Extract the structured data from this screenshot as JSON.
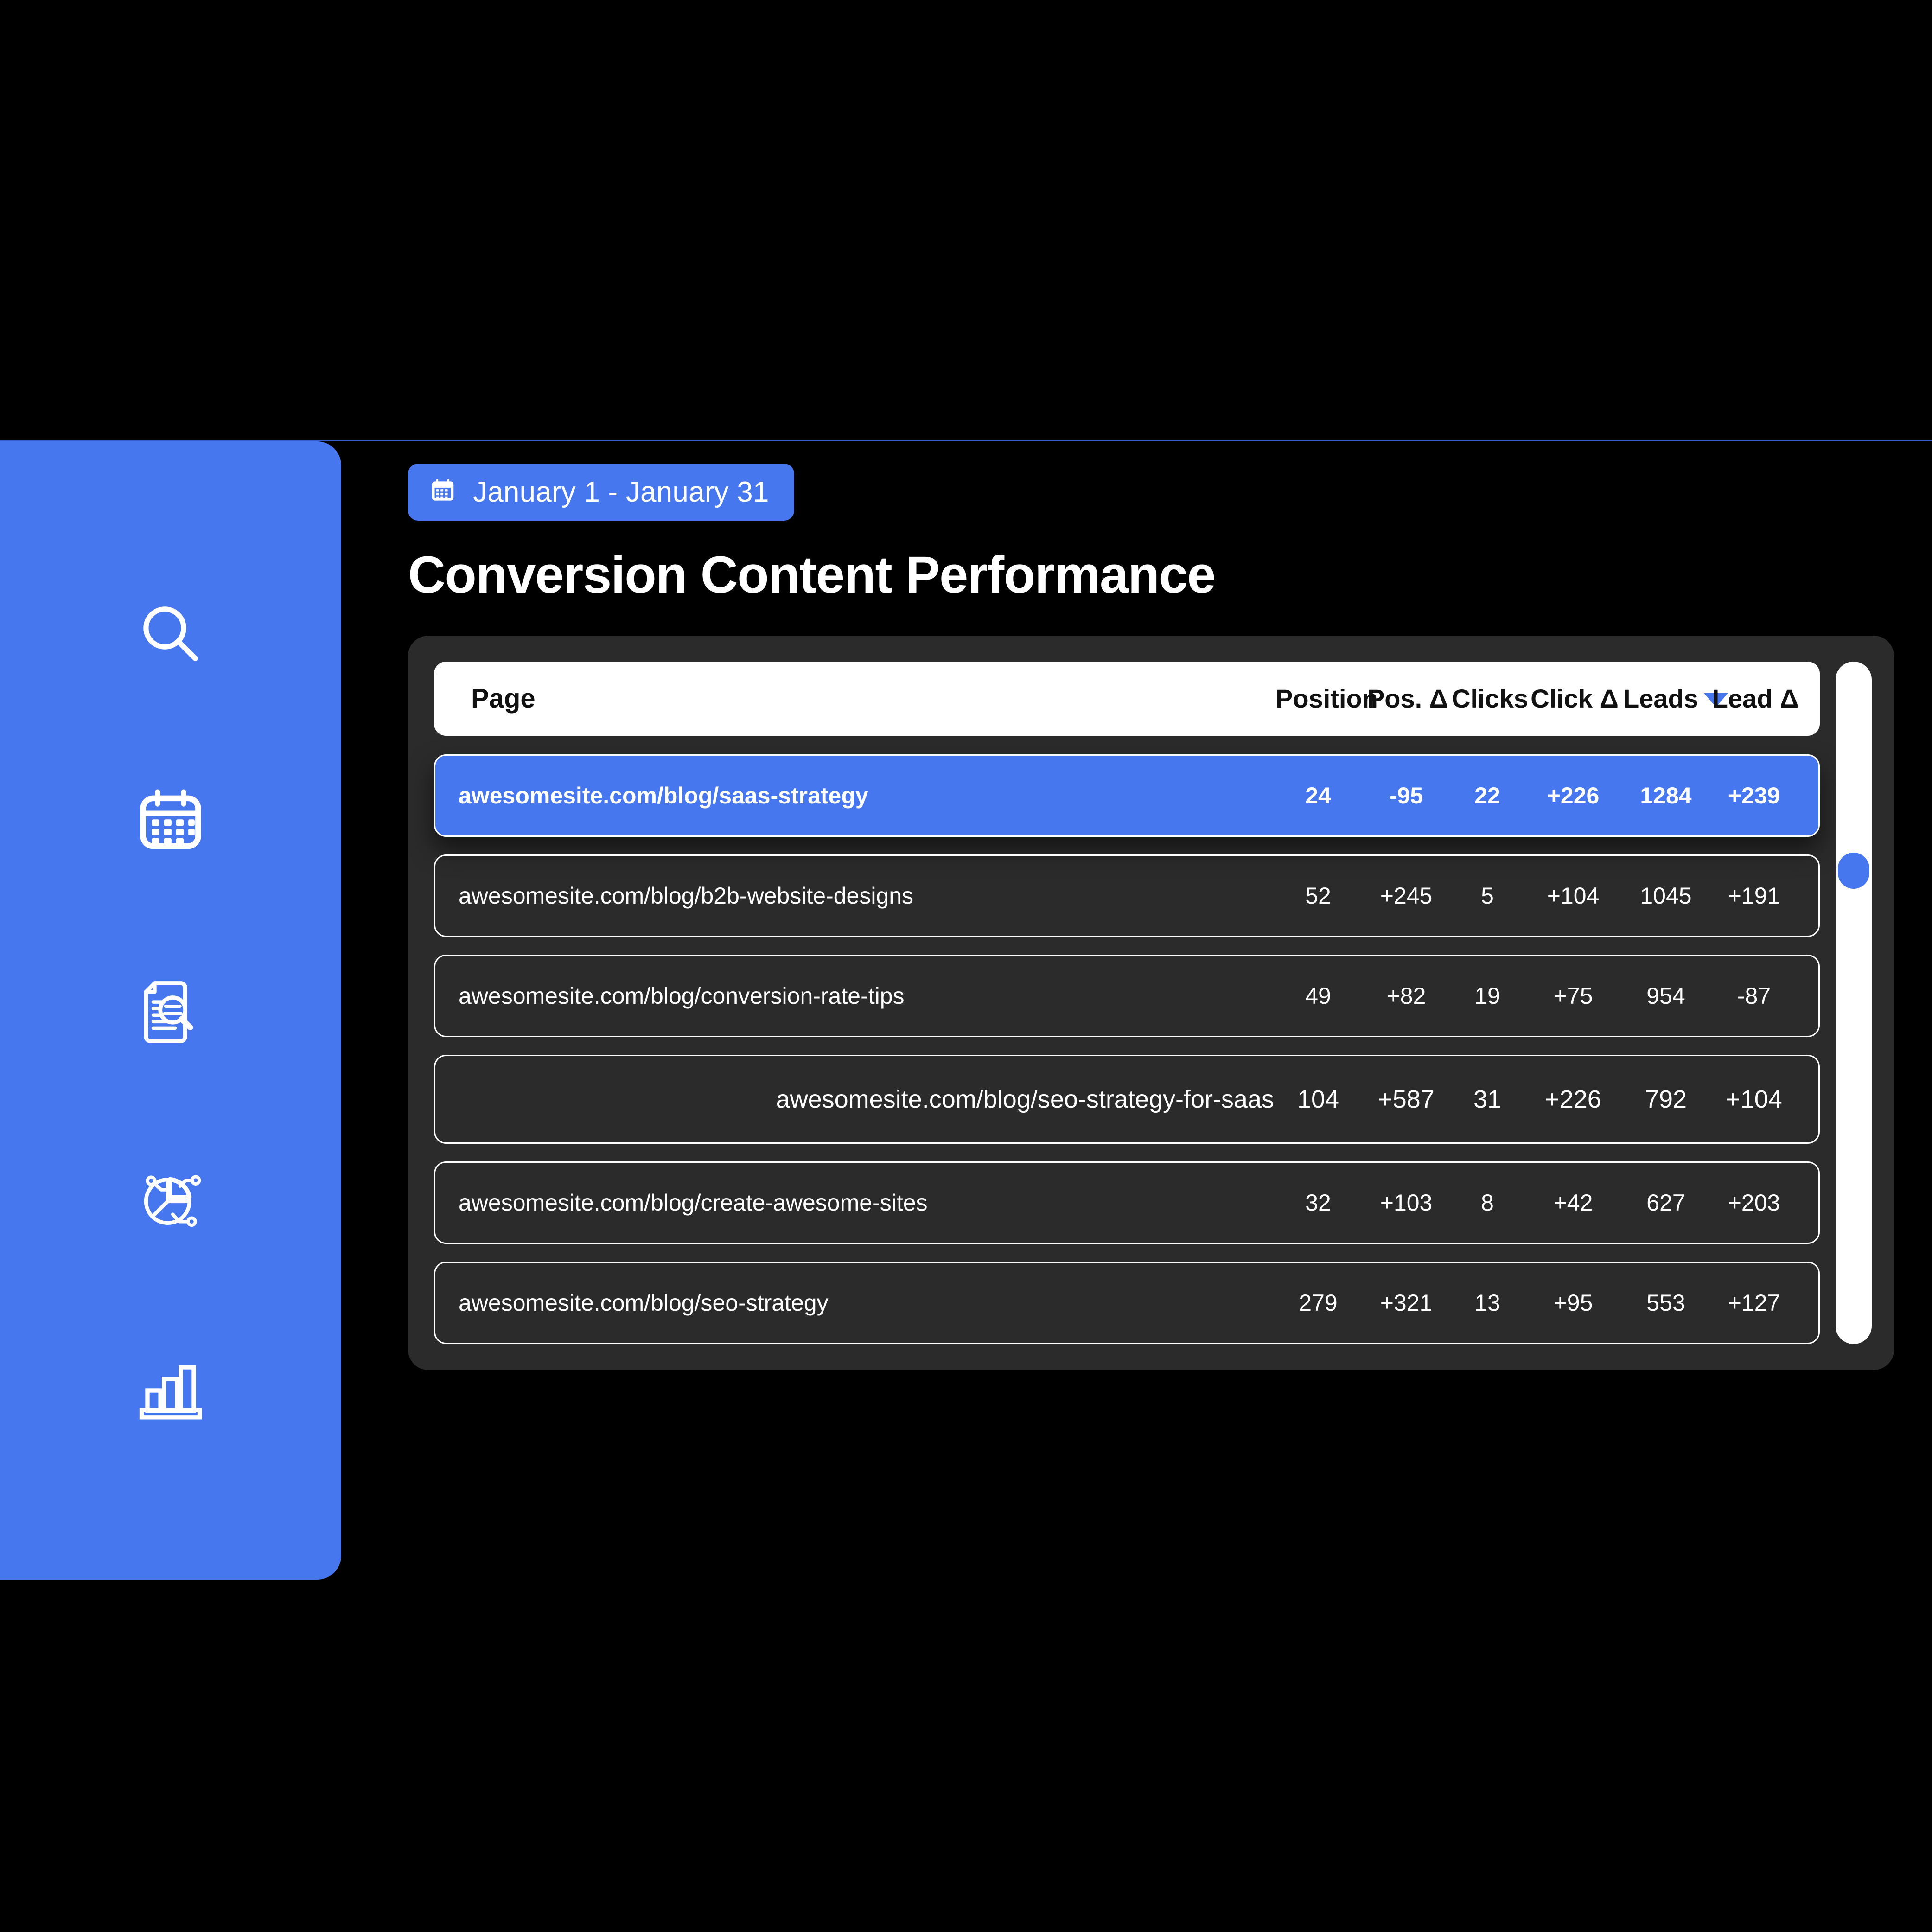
{
  "theme": {
    "background": "#000000",
    "accent": "#4777ee",
    "card_background": "#2b2b2b",
    "header_background": "#ffffff",
    "text_on_dark": "#ffffff",
    "text_on_light": "#111111",
    "divider": "#3b5ccc"
  },
  "sidebar": {
    "items": [
      {
        "icon": "search-icon",
        "name": "sidebar-item-search"
      },
      {
        "icon": "calendar-icon",
        "name": "sidebar-item-calendar"
      },
      {
        "icon": "document-search-icon",
        "name": "sidebar-item-reports"
      },
      {
        "icon": "pie-chart-icon",
        "name": "sidebar-item-analytics"
      },
      {
        "icon": "bar-chart-icon",
        "name": "sidebar-item-performance"
      }
    ]
  },
  "header": {
    "date_range": "January 1 - January 31",
    "date_icon": "calendar-icon",
    "title": "Conversion Content Performance"
  },
  "table": {
    "sort": {
      "column": "Leads",
      "direction": "desc",
      "indicator": "chevron-down-icon"
    },
    "columns": [
      {
        "key": "page",
        "label": "Page"
      },
      {
        "key": "position",
        "label": "Position"
      },
      {
        "key": "pos_d",
        "label": "Pos. Δ"
      },
      {
        "key": "clicks",
        "label": "Clicks"
      },
      {
        "key": "click_d",
        "label": "Click Δ"
      },
      {
        "key": "leads",
        "label": "Leads"
      },
      {
        "key": "lead_d",
        "label": "Lead Δ"
      }
    ],
    "rows": [
      {
        "page": "awesomesite.com/blog/saas-strategy",
        "position": "24",
        "pos_d": "-95",
        "clicks": "22",
        "click_d": "+226",
        "leads": "1284",
        "lead_d": "+239",
        "selected": true
      },
      {
        "page": "awesomesite.com/blog/b2b-website-designs",
        "position": "52",
        "pos_d": "+245",
        "clicks": "5",
        "click_d": "+104",
        "leads": "1045",
        "lead_d": "+191",
        "selected": false
      },
      {
        "page": "awesomesite.com/blog/conversion-rate-tips",
        "position": "49",
        "pos_d": "+82",
        "clicks": "19",
        "click_d": "+75",
        "leads": "954",
        "lead_d": "-87",
        "selected": false
      },
      {
        "page": "awesomesite.com/blog/seo-strategy-for-saas",
        "position": "104",
        "pos_d": "+587",
        "clicks": "31",
        "click_d": "+226",
        "leads": "792",
        "lead_d": "+104",
        "selected": false
      },
      {
        "page": "awesomesite.com/blog/create-awesome-sites",
        "position": "32",
        "pos_d": "+103",
        "clicks": "8",
        "click_d": "+42",
        "leads": "627",
        "lead_d": "+203",
        "selected": false
      },
      {
        "page": "awesomesite.com/blog/seo-strategy",
        "position": "279",
        "pos_d": "+321",
        "clicks": "13",
        "click_d": "+95",
        "leads": "553",
        "lead_d": "+127",
        "selected": false
      }
    ]
  },
  "scrollbar": {
    "thumb_position_percent": 28
  }
}
